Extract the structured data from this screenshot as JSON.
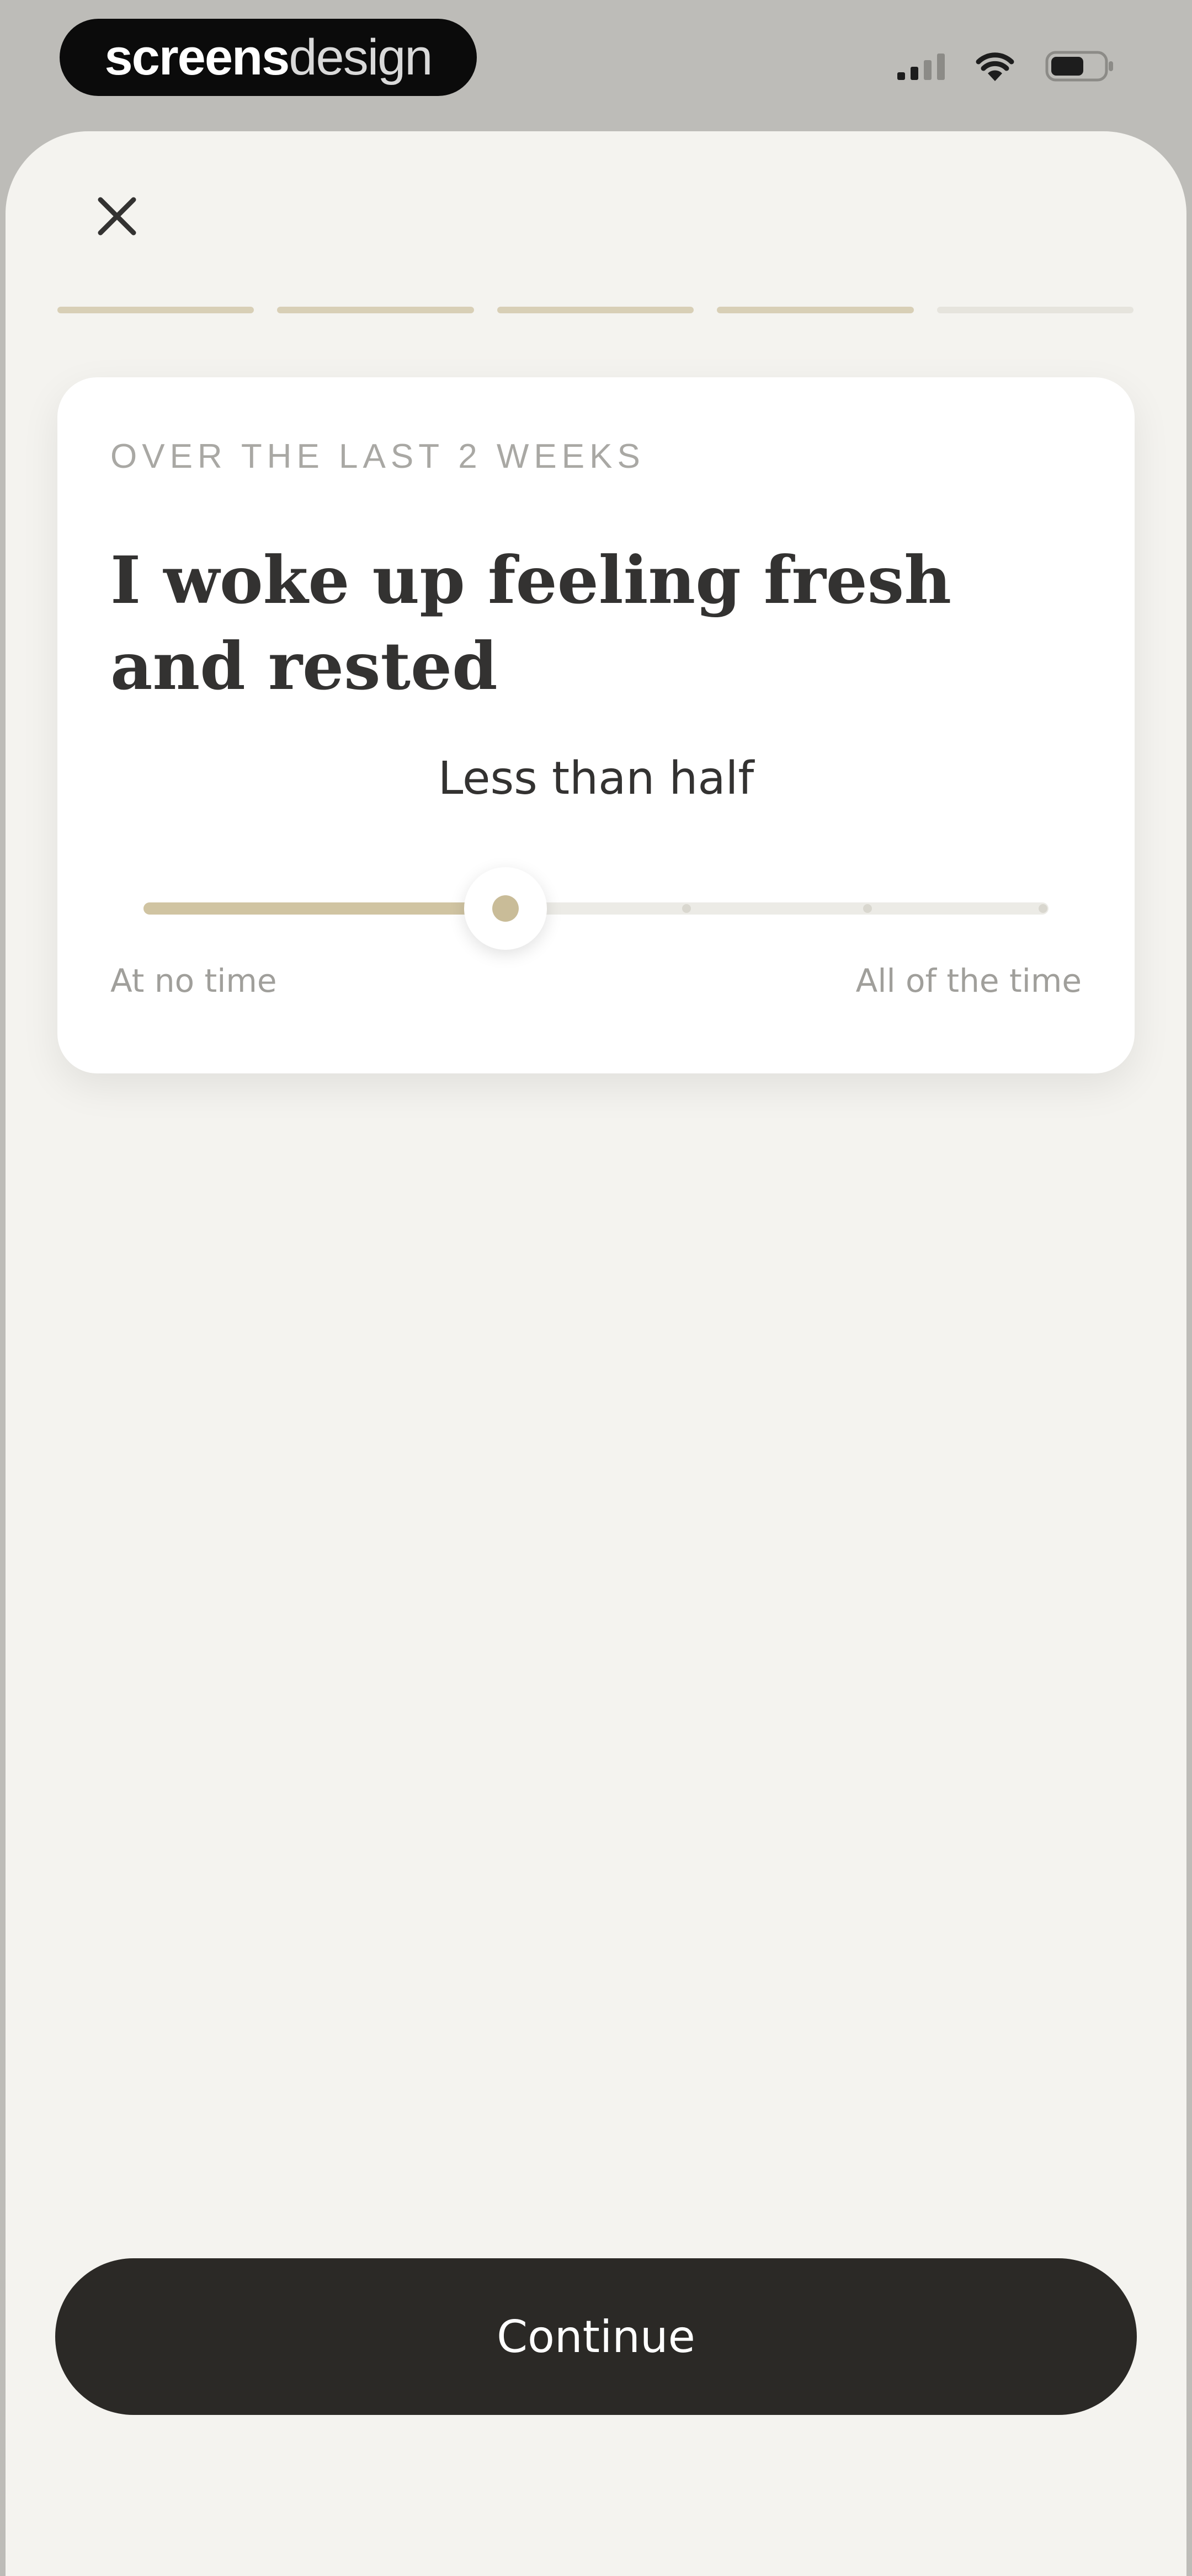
{
  "status_bar": {
    "brand_bold": "screens",
    "brand_light": "design",
    "icons": [
      "signal-icon",
      "wifi-icon",
      "battery-icon"
    ]
  },
  "header": {
    "close_icon": "close-icon"
  },
  "progress": {
    "total_steps": 5,
    "completed_steps": 4
  },
  "question_card": {
    "eyebrow": "OVER THE LAST 2 WEEKS",
    "question": "I woke up feeling fresh and rested",
    "answer": "Less than half",
    "scale": {
      "min_label": "At no time",
      "max_label": "All of the time",
      "steps": 6,
      "value_fraction": 0.4
    }
  },
  "footer": {
    "continue_label": "Continue"
  },
  "colors": {
    "background": "#f4f3ef",
    "accent": "#d0c4a2",
    "button": "#2b2926",
    "text": "#333231"
  }
}
